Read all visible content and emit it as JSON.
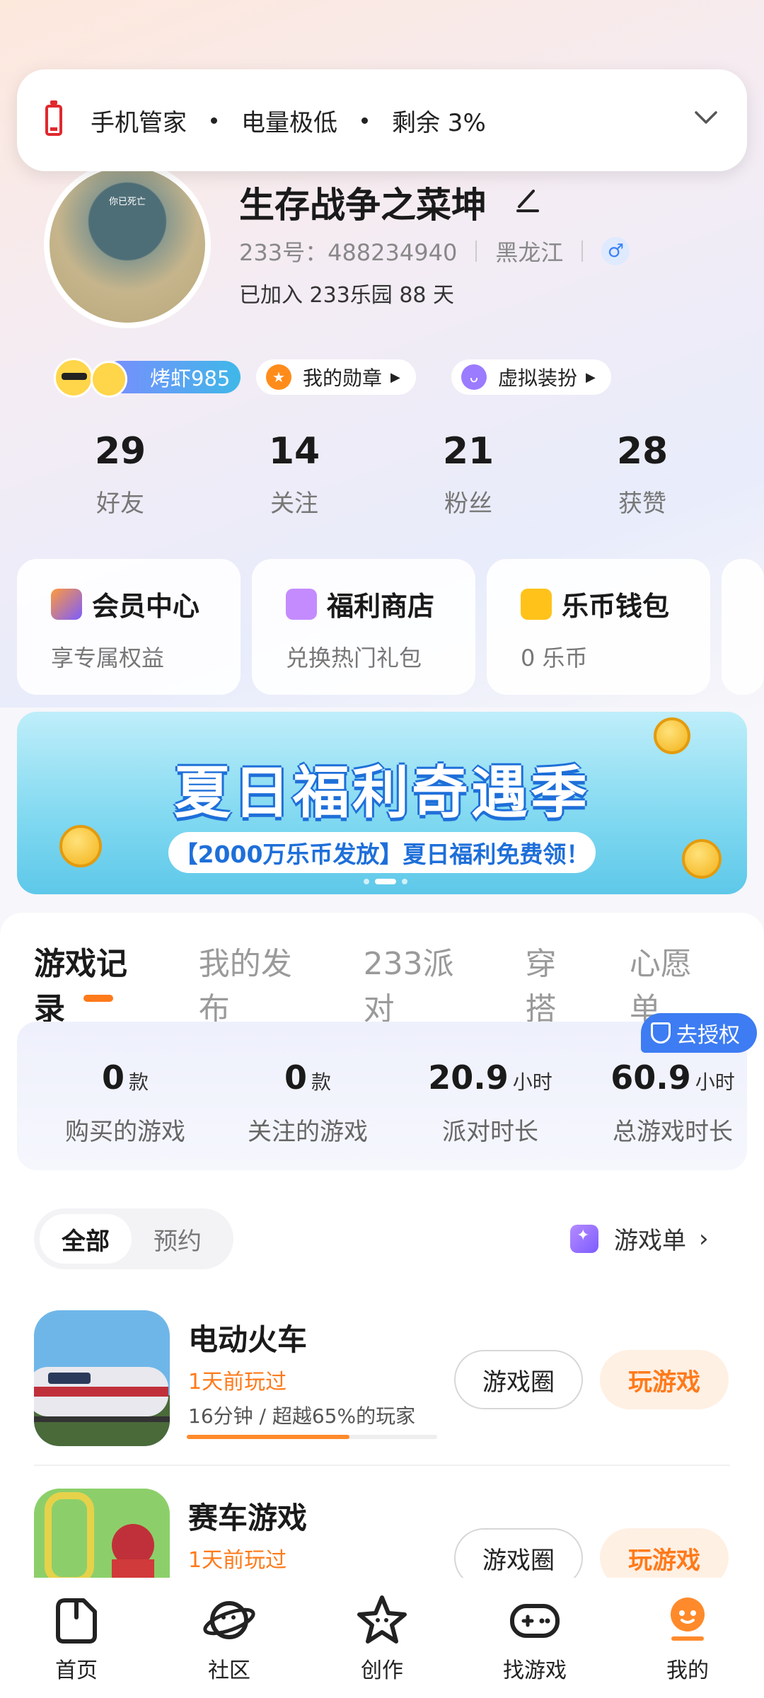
{
  "notification": {
    "app": "手机管家",
    "message": "电量极低",
    "remaining": "剩余 3%"
  },
  "profile": {
    "avatar_caption": "你已死亡",
    "name": "生存战争之菜坤",
    "uid": "233号：488234940",
    "region": "黑龙江",
    "gender_symbol": "♂",
    "joined": "已加入 233乐园 88 天"
  },
  "chips": {
    "level": "烤虾985",
    "medals": "我的勋章",
    "outfit": "虚拟装扮"
  },
  "stats": [
    {
      "value": "29",
      "label": "好友"
    },
    {
      "value": "14",
      "label": "关注"
    },
    {
      "value": "21",
      "label": "粉丝"
    },
    {
      "value": "28",
      "label": "获赞"
    }
  ],
  "quick_cards": [
    {
      "title": "会员中心",
      "sub": "享专属权益",
      "color": "#7b5cff"
    },
    {
      "title": "福利商店",
      "sub": "兑换热门礼包",
      "color": "#c48bff"
    },
    {
      "title": "乐币钱包",
      "sub": "0 乐币",
      "color": "#ffc21a"
    }
  ],
  "banner": {
    "title": "夏日福利奇遇季",
    "subtitle": "【2000万乐币发放】夏日福利免费领！"
  },
  "tabs": [
    "游戏记录",
    "我的发布",
    "233派对",
    "穿搭",
    "心愿单"
  ],
  "play_stats": [
    {
      "value": "0",
      "unit": "款",
      "label": "购买的游戏"
    },
    {
      "value": "0",
      "unit": "款",
      "label": "关注的游戏"
    },
    {
      "value": "20.9",
      "unit": "小时",
      "label": "派对时长"
    },
    {
      "value": "60.9",
      "unit": "小时",
      "label": "总游戏时长"
    }
  ],
  "authorize_label": "去授权",
  "filter": {
    "all": "全部",
    "reserve": "预约"
  },
  "game_list_label": "游戏单",
  "games": [
    {
      "name": "电动火车",
      "last_played": "1天前玩过",
      "desc": "16分钟 / 超越65%的玩家",
      "progress": 0.65,
      "circle": "游戏圈",
      "play": "玩游戏"
    },
    {
      "name": "赛车游戏",
      "last_played": "1天前玩过",
      "circle": "游戏圈",
      "play": "玩游戏"
    }
  ],
  "bottom_nav": [
    {
      "label": "首页",
      "icon": "home-icon"
    },
    {
      "label": "社区",
      "icon": "planet-icon"
    },
    {
      "label": "创作",
      "icon": "star-icon"
    },
    {
      "label": "找游戏",
      "icon": "gamepad-icon"
    },
    {
      "label": "我的",
      "icon": "profile-icon"
    }
  ],
  "colors": {
    "accent": "#ff7a1a",
    "auth_blue": "#3d7cf2"
  }
}
